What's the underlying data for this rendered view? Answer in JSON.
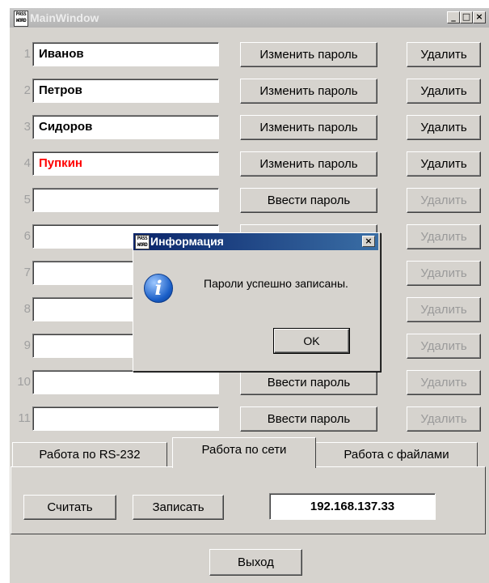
{
  "window": {
    "app_icon_text": "PASS WORD",
    "title": "MainWindow",
    "btn_minimize": "_",
    "btn_maximize": "□",
    "btn_close": "×"
  },
  "rows": [
    {
      "num": "1",
      "name": "Иванов",
      "name_color": "#000000",
      "action": "Изменить пароль",
      "delete": "Удалить",
      "delete_enabled": true
    },
    {
      "num": "2",
      "name": "Петров",
      "name_color": "#000000",
      "action": "Изменить пароль",
      "delete": "Удалить",
      "delete_enabled": true
    },
    {
      "num": "3",
      "name": "Сидоров",
      "name_color": "#000000",
      "action": "Изменить пароль",
      "delete": "Удалить",
      "delete_enabled": true
    },
    {
      "num": "4",
      "name": "Пупкин",
      "name_color": "#ff0000",
      "action": "Изменить пароль",
      "delete": "Удалить",
      "delete_enabled": true
    },
    {
      "num": "5",
      "name": "",
      "action": "Ввести пароль",
      "delete": "Удалить",
      "delete_enabled": false
    },
    {
      "num": "6",
      "name": "",
      "action": "",
      "delete": "Удалить",
      "delete_enabled": false
    },
    {
      "num": "7",
      "name": "",
      "action": "",
      "delete": "Удалить",
      "delete_enabled": false
    },
    {
      "num": "8",
      "name": "",
      "action": "",
      "delete": "Удалить",
      "delete_enabled": false
    },
    {
      "num": "9",
      "name": "",
      "action": "",
      "delete": "Удалить",
      "delete_enabled": false
    },
    {
      "num": "10",
      "name": "",
      "action": "Ввести пароль",
      "delete": "Удалить",
      "delete_enabled": false
    },
    {
      "num": "11",
      "name": "",
      "action": "Ввести пароль",
      "delete": "Удалить",
      "delete_enabled": false
    }
  ],
  "tabs": [
    {
      "label": "Работа по RS-232",
      "active": false
    },
    {
      "label": "Работа по сети",
      "active": true
    },
    {
      "label": "Работа с файлами",
      "active": false
    }
  ],
  "network": {
    "read_label": "Считать",
    "write_label": "Записать",
    "ip": "192.168.137.33"
  },
  "exit_label": "Выход",
  "dialog": {
    "icon_text": "PASS WORD",
    "title": "Информация",
    "close": "×",
    "info_icon": "i",
    "message": "Пароли успешно записаны.",
    "ok_label": "OK"
  }
}
